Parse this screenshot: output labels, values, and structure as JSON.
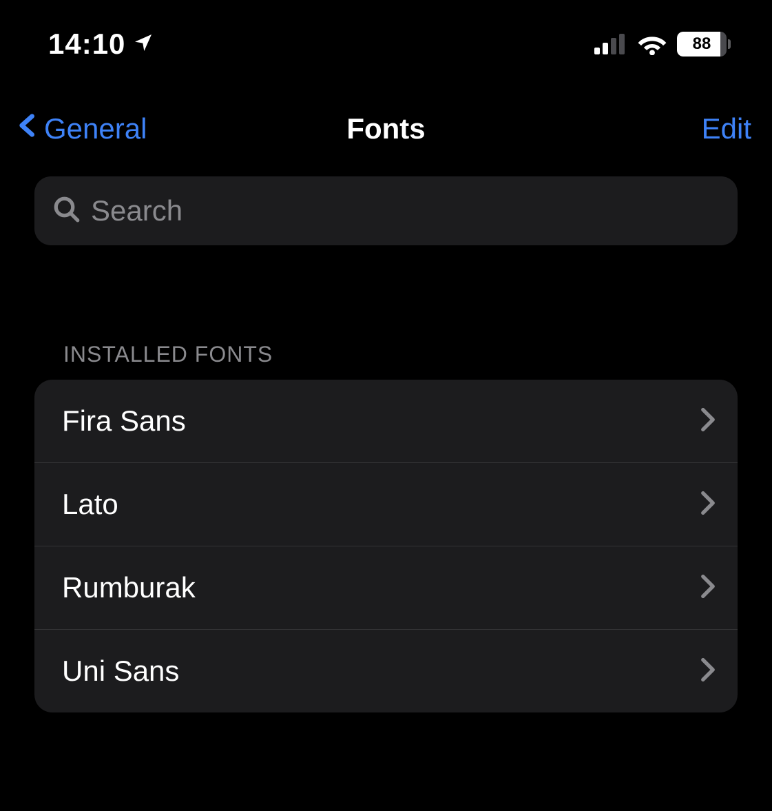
{
  "status": {
    "time": "14:10",
    "battery": "88"
  },
  "nav": {
    "back_label": "General",
    "title": "Fonts",
    "edit_label": "Edit"
  },
  "search": {
    "placeholder": "Search"
  },
  "section": {
    "header": "INSTALLED FONTS",
    "items": [
      {
        "label": "Fira Sans"
      },
      {
        "label": "Lato"
      },
      {
        "label": "Rumburak"
      },
      {
        "label": "Uni Sans"
      }
    ]
  }
}
